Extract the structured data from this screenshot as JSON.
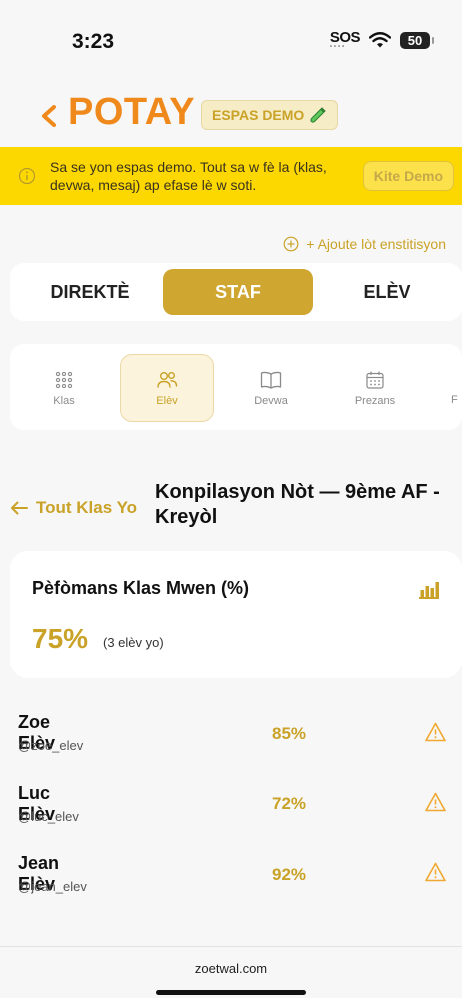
{
  "status_bar": {
    "time": "3:23",
    "sos": "SOS",
    "battery": "50",
    "icons": [
      "wifi-icon",
      "battery-icon"
    ]
  },
  "header": {
    "brand": "POTAY",
    "demo_badge": "ESPAS DEMO",
    "back_icon": "chevron-left-icon"
  },
  "banner": {
    "text": "Sa se yon espas demo. Tout sa w fè la (klas, devwa, mesaj) ap efase lè w soti.",
    "button": "Kite Demo",
    "icon": "info-icon"
  },
  "add_institution": "+ Ajoute lòt enstitisyon",
  "role_tabs": [
    {
      "label": "DIREKTÈ",
      "active": false
    },
    {
      "label": "STAF",
      "active": true
    },
    {
      "label": "ELÈV",
      "active": false
    }
  ],
  "section_tabs": [
    {
      "label": "Klas",
      "icon": "grid-icon",
      "active": false
    },
    {
      "label": "Elèv",
      "icon": "users-icon",
      "active": true
    },
    {
      "label": "Devwa",
      "icon": "book-icon",
      "active": false
    },
    {
      "label": "Prezans",
      "icon": "calendar-icon",
      "active": false
    }
  ],
  "breadcrumb": {
    "back_label": "Tout Klas Yo",
    "title": "Konpilasyon Nòt — 9ème AF - Kreyòl"
  },
  "performance": {
    "title": "Pèfòmans Klas Mwen (%)",
    "value": "75%",
    "subtitle": "(3 elèv yo)"
  },
  "students": [
    {
      "name": "Zoe Elèv",
      "handle": "@zoe_elev",
      "percent": "85%"
    },
    {
      "name": "Luc Elèv",
      "handle": "@luc_elev",
      "percent": "72%"
    },
    {
      "name": "Jean Elèv",
      "handle": "@jean_elev",
      "percent": "92%"
    }
  ],
  "footer": "zoetwal.com",
  "colors": {
    "accent": "#cfa630",
    "brand": "#f0891c",
    "banner": "#fcd800",
    "warning": "#f0a830"
  }
}
